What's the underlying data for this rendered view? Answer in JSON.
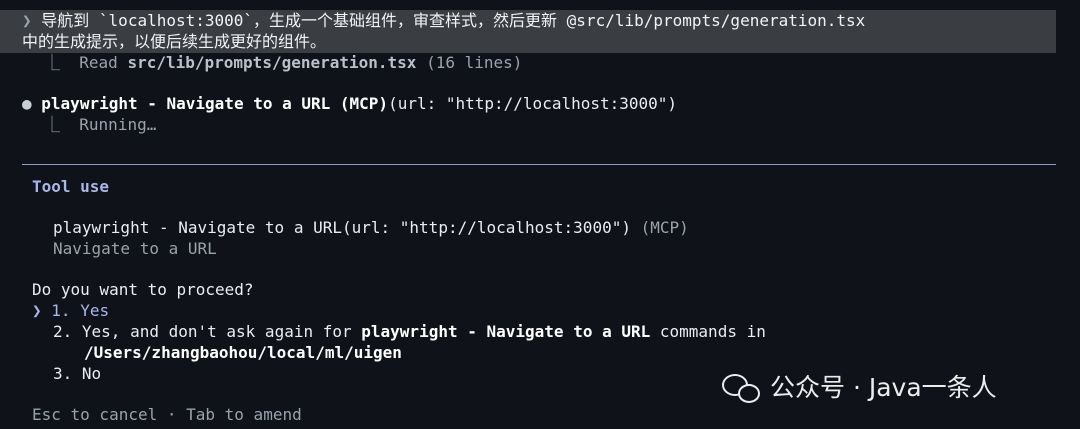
{
  "prompt": {
    "chevron": "❯",
    "line1": "导航到 `localhost:3000`，生成一个基础组件，审查样式，然后更新 @src/lib/prompts/generation.tsx",
    "line2": "中的生成提示，以便后续生成更好的组件。"
  },
  "read_result": {
    "branch": "⎿",
    "verb": "Read",
    "path": "src/lib/prompts/generation.tsx",
    "meta": "(16 lines)"
  },
  "tool_call": {
    "bullet": "●",
    "name": "playwright - Navigate to a URL (MCP)",
    "args": "(url: \"http://localhost:3000\")",
    "status_branch": "⎿",
    "status": "Running…"
  },
  "dialog": {
    "heading": "Tool use",
    "call": "playwright - Navigate to a URL(url: \"http://localhost:3000\")",
    "call_tag": "(MCP)",
    "description": "Navigate to a URL",
    "question": "Do you want to proceed?",
    "options": [
      {
        "marker": "❯",
        "number": "1.",
        "label": "Yes"
      },
      {
        "marker": "",
        "number": "2.",
        "label_prefix": "Yes, and don't ask again for",
        "label_bold": "playwright - Navigate to a URL",
        "label_suffix": "commands in",
        "label_path": "/Users/zhangbaohou/local/ml/uigen"
      },
      {
        "marker": "",
        "number": "3.",
        "label": "No"
      }
    ],
    "footer": "Esc to cancel · Tab to amend"
  },
  "watermark": {
    "icon": "wechat-icon",
    "text": "公众号 · Java一条人"
  },
  "colors": {
    "background": "#0f1319",
    "prompt_bg": "#3a3d42",
    "accent": "#a9b6ea",
    "dim": "#9aa2ad"
  }
}
